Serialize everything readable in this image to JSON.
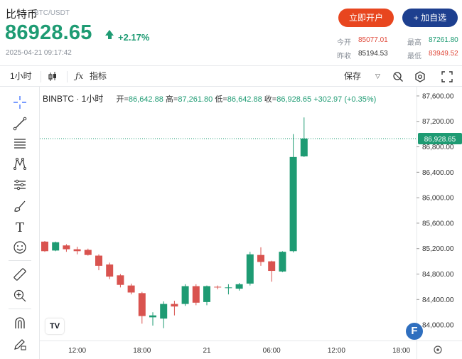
{
  "header": {
    "coin_name": "比特币",
    "pair": "BTC/USDT",
    "price": "86928.65",
    "change_pct": "+2.17%",
    "timestamp": "2025-04-21 09:17:42",
    "open_account_label": "立即开户",
    "add_watch_label": "+ 加自选",
    "stats": {
      "open_label": "今开",
      "open_value": "85077.01",
      "high_label": "最高",
      "high_value": "87261.80",
      "prev_label": "昨收",
      "prev_value": "85194.53",
      "low_label": "最低",
      "low_value": "83949.52"
    }
  },
  "toolbar": {
    "interval": "1小时",
    "indicators_label": "指标",
    "save_label": "保存"
  },
  "legend": {
    "symbol": "BINBTC · 1小时",
    "open_label": "开",
    "open_value": "86,642.88",
    "high_label": "高",
    "high_value": "87,261.80",
    "low_label": "低",
    "low_value": "86,642.88",
    "close_label": "收",
    "close_value": "86,928.65",
    "change": "+302.97 (+0.35%)"
  },
  "colors": {
    "up": "#1e9b73",
    "down": "#d9534f",
    "accent": "#e8461f",
    "brand": "#1d3f8f"
  },
  "chart_data": {
    "type": "candlestick",
    "title": "",
    "ylim": [
      83800,
      87700
    ],
    "y_ticks": [
      "84,000.00",
      "84,400.00",
      "84,800.00",
      "85,200.00",
      "85,600.00",
      "86,000.00",
      "86,400.00",
      "86,800.00",
      "87,200.00",
      "87,600.00"
    ],
    "y_tick_values": [
      84000,
      84400,
      84800,
      85200,
      85600,
      86000,
      86400,
      86800,
      87200,
      87600
    ],
    "x_ticks": [
      "12:00",
      "18:00",
      "21",
      "06:00",
      "12:00",
      "18:00"
    ],
    "x_tick_index": [
      3,
      9,
      15,
      21,
      27,
      33
    ],
    "last_price": 86928.65,
    "last_price_label": "86,928.65",
    "candles": [
      {
        "o": 85310,
        "h": 85320,
        "l": 85150,
        "c": 85160
      },
      {
        "o": 85170,
        "h": 85310,
        "l": 85160,
        "c": 85300
      },
      {
        "o": 85250,
        "h": 85270,
        "l": 85150,
        "c": 85190
      },
      {
        "o": 85190,
        "h": 85230,
        "l": 85110,
        "c": 85160
      },
      {
        "o": 85180,
        "h": 85200,
        "l": 85090,
        "c": 85100
      },
      {
        "o": 85090,
        "h": 85110,
        "l": 84860,
        "c": 84930
      },
      {
        "o": 84950,
        "h": 84980,
        "l": 84720,
        "c": 84760
      },
      {
        "o": 84780,
        "h": 84800,
        "l": 84590,
        "c": 84630
      },
      {
        "o": 84620,
        "h": 84650,
        "l": 84480,
        "c": 84510
      },
      {
        "o": 84500,
        "h": 84520,
        "l": 84020,
        "c": 84140
      },
      {
        "o": 84120,
        "h": 84200,
        "l": 83990,
        "c": 84150
      },
      {
        "o": 84100,
        "h": 84370,
        "l": 83950,
        "c": 84330
      },
      {
        "o": 84330,
        "h": 84380,
        "l": 84150,
        "c": 84290
      },
      {
        "o": 84330,
        "h": 84640,
        "l": 84300,
        "c": 84610
      },
      {
        "o": 84610,
        "h": 84640,
        "l": 84310,
        "c": 84350
      },
      {
        "o": 84360,
        "h": 84620,
        "l": 84310,
        "c": 84610
      },
      {
        "o": 84600,
        "h": 84620,
        "l": 84560,
        "c": 84590
      },
      {
        "o": 84580,
        "h": 84640,
        "l": 84480,
        "c": 84590
      },
      {
        "o": 84570,
        "h": 84660,
        "l": 84540,
        "c": 84640
      },
      {
        "o": 84650,
        "h": 85150,
        "l": 84620,
        "c": 85110
      },
      {
        "o": 85100,
        "h": 85220,
        "l": 84930,
        "c": 84990
      },
      {
        "o": 85000,
        "h": 85010,
        "l": 84680,
        "c": 84850
      },
      {
        "o": 84840,
        "h": 85160,
        "l": 84830,
        "c": 85150
      },
      {
        "o": 85160,
        "h": 87000,
        "l": 85140,
        "c": 86640
      },
      {
        "o": 86650,
        "h": 87262,
        "l": 86640,
        "c": 86930
      }
    ]
  }
}
